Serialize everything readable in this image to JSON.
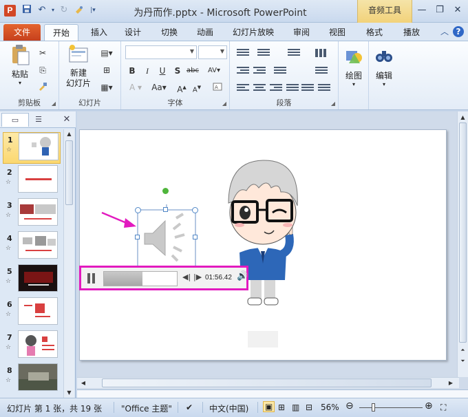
{
  "window": {
    "title": "为丹而作.pptx - Microsoft PowerPoint",
    "context_tab_header": "音频工具"
  },
  "tabs": [
    {
      "label": "文件"
    },
    {
      "label": "开始"
    },
    {
      "label": "插入"
    },
    {
      "label": "设计"
    },
    {
      "label": "切换"
    },
    {
      "label": "动画"
    },
    {
      "label": "幻灯片放映"
    },
    {
      "label": "审阅"
    },
    {
      "label": "视图"
    },
    {
      "label": "格式"
    },
    {
      "label": "播放"
    }
  ],
  "ribbon": {
    "clipboard": {
      "label": "剪贴板",
      "paste": "粘贴"
    },
    "slides": {
      "label": "幻灯片",
      "new_slide": "新建\n幻灯片"
    },
    "font": {
      "label": "字体"
    },
    "paragraph": {
      "label": "段落"
    },
    "drawing": {
      "label": "绘图"
    },
    "editing": {
      "label": "编辑"
    }
  },
  "slides_panel": {
    "slides": [
      {
        "number": "1"
      },
      {
        "number": "2"
      },
      {
        "number": "3"
      },
      {
        "number": "4"
      },
      {
        "number": "5"
      },
      {
        "number": "6"
      },
      {
        "number": "7"
      },
      {
        "number": "8"
      }
    ]
  },
  "player": {
    "time": "01:56.42",
    "progress": 0.53
  },
  "status_bar": {
    "slide_info": "幻灯片 第 1 张，共 19 张",
    "theme": "\"Office 主题\"",
    "language": "中文(中国)",
    "zoom": "56%"
  },
  "colors": {
    "highlight_border": "#e21abf",
    "file_tab": "#d24726",
    "selection_handle": "#4f86c6",
    "rotation_handle": "#4fb53b"
  }
}
